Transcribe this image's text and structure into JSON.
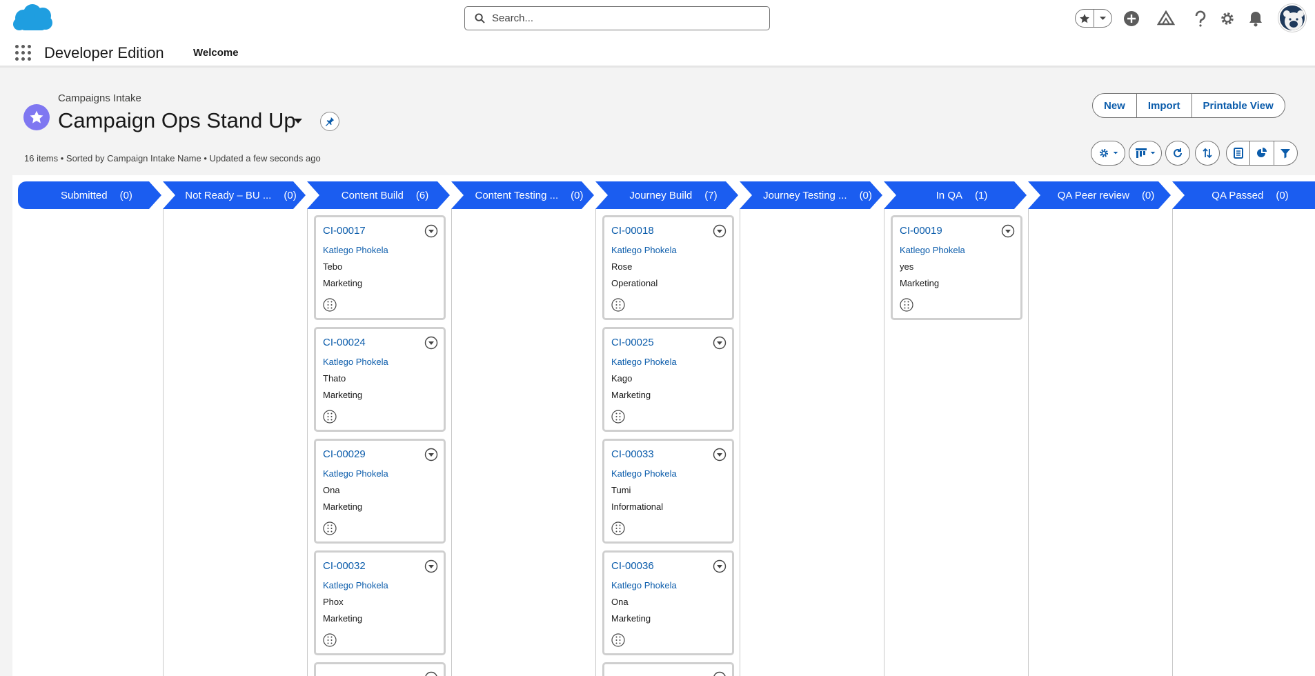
{
  "header": {
    "search_placeholder": "Search...",
    "icons": [
      "salesforce-cloud-logo",
      "star-icon",
      "chevron-down-icon",
      "add-icon",
      "trailhead-icon",
      "help-icon",
      "setup-gear-icon",
      "bell-icon",
      "avatar"
    ]
  },
  "nav": {
    "app_name": "Developer Edition",
    "items": [
      {
        "label": "Welcome"
      }
    ]
  },
  "page": {
    "object_label": "Campaigns Intake",
    "list_view_title": "Campaign Ops Stand Up",
    "meta": "16 items • Sorted by Campaign Intake Name • Updated a few seconds ago",
    "actions": {
      "new": "New",
      "import": "Import",
      "printable": "Printable View"
    }
  },
  "colors": {
    "brand": "#1b5df0",
    "link": "#0b5cab",
    "object_icon": "#7f77f1"
  },
  "stages": [
    {
      "label": "Submitted",
      "count": "(0)"
    },
    {
      "label": "Not Ready – BU ...",
      "count": "(0)"
    },
    {
      "label": "Content Build",
      "count": "(6)"
    },
    {
      "label": "Content Testing ...",
      "count": "(0)"
    },
    {
      "label": "Journey Build",
      "count": "(7)"
    },
    {
      "label": "Journey Testing ...",
      "count": "(0)"
    },
    {
      "label": "In QA",
      "count": "(1)"
    },
    {
      "label": "QA Peer review",
      "count": "(0)"
    },
    {
      "label": "QA Passed",
      "count": "(0)"
    }
  ],
  "columns": {
    "content_build": [
      {
        "id": "CI-00017",
        "owner": "Katlego Phokela",
        "f1": "Tebo",
        "f2": "Marketing"
      },
      {
        "id": "CI-00024",
        "owner": "Katlego Phokela",
        "f1": "Thato",
        "f2": "Marketing"
      },
      {
        "id": "CI-00029",
        "owner": "Katlego Phokela",
        "f1": "Ona",
        "f2": "Marketing"
      },
      {
        "id": "CI-00032",
        "owner": "Katlego Phokela",
        "f1": "Phox",
        "f2": "Marketing"
      }
    ],
    "journey_build": [
      {
        "id": "CI-00018",
        "owner": "Katlego Phokela",
        "f1": "Rose",
        "f2": "Operational"
      },
      {
        "id": "CI-00025",
        "owner": "Katlego Phokela",
        "f1": "Kago",
        "f2": "Marketing"
      },
      {
        "id": "CI-00033",
        "owner": "Katlego Phokela",
        "f1": "Tumi",
        "f2": "Informational"
      },
      {
        "id": "CI-00036",
        "owner": "Katlego Phokela",
        "f1": "Ona",
        "f2": "Marketing"
      }
    ],
    "in_qa": [
      {
        "id": "CI-00019",
        "owner": "Katlego Phokela",
        "f1": "yes",
        "f2": "Marketing"
      }
    ]
  }
}
